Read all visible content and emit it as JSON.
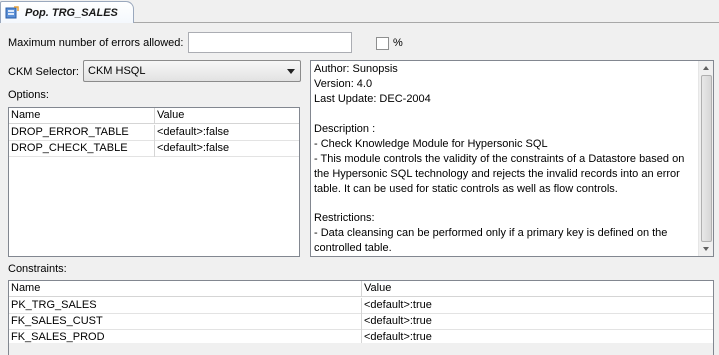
{
  "tab": {
    "title": "Pop. TRG_SALES",
    "icon": "datastore-icon"
  },
  "errors": {
    "label": "Maximum number of errors allowed:",
    "value": "",
    "percent_label": "%",
    "percent_checked": false
  },
  "ckm": {
    "label": "CKM Selector:",
    "selected": "CKM HSQL"
  },
  "options": {
    "label": "Options:",
    "columns": [
      "Name",
      "Value"
    ],
    "rows": [
      {
        "name": "DROP_ERROR_TABLE",
        "value": "<default>:false"
      },
      {
        "name": "DROP_CHECK_TABLE",
        "value": "<default>:false"
      }
    ]
  },
  "description": {
    "lines": [
      "Author: Sunopsis",
      "Version: 4.0",
      "Last Update: DEC-2004",
      "",
      "Description :",
      "- Check Knowledge Module for Hypersonic SQL",
      "- This module controls the validity of the constraints of a Datastore based on",
      "the Hypersonic SQL technology and rejects the invalid records into an error",
      "table. It can be used for static controls as well as flow controls.",
      "",
      "Restrictions:",
      "- Data cleansing can be performed only if a primary key is defined on the",
      "controlled table."
    ]
  },
  "constraints": {
    "label": "Constraints:",
    "columns": [
      "Name",
      "Value"
    ],
    "rows": [
      {
        "name": "PK_TRG_SALES",
        "value": "<default>:true"
      },
      {
        "name": "FK_SALES_CUST",
        "value": "<default>:true"
      },
      {
        "name": "FK_SALES_PROD",
        "value": "<default>:true"
      }
    ]
  }
}
